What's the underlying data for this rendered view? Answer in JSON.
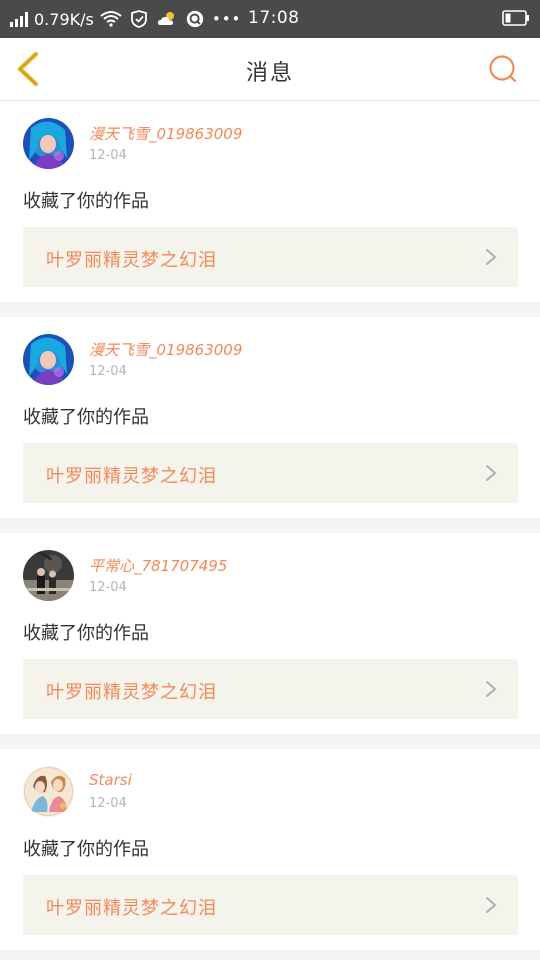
{
  "status": {
    "speed": "0.79K/s",
    "time": "17:08"
  },
  "nav": {
    "title": "消息"
  },
  "messages": [
    {
      "username": "漫天飞雪_019863009",
      "date": "12-04",
      "action": "收藏了你的作品",
      "work": "叶罗丽精灵梦之幻泪",
      "avatar": "avatar-1"
    },
    {
      "username": "漫天飞雪_019863009",
      "date": "12-04",
      "action": "收藏了你的作品",
      "work": "叶罗丽精灵梦之幻泪",
      "avatar": "avatar-1"
    },
    {
      "username": "平常心_781707495",
      "date": "12-04",
      "action": "收藏了你的作品",
      "work": "叶罗丽精灵梦之幻泪",
      "avatar": "avatar-2"
    },
    {
      "username": "Starsi",
      "date": "12-04",
      "action": "收藏了你的作品",
      "work": "叶罗丽精灵梦之幻泪",
      "avatar": "avatar-3"
    }
  ],
  "colors": {
    "accent": "#f08a58",
    "back_arrow": "#e8b82a",
    "statusbar": "#4a4a4a",
    "work_bg": "#f4f3ec"
  }
}
